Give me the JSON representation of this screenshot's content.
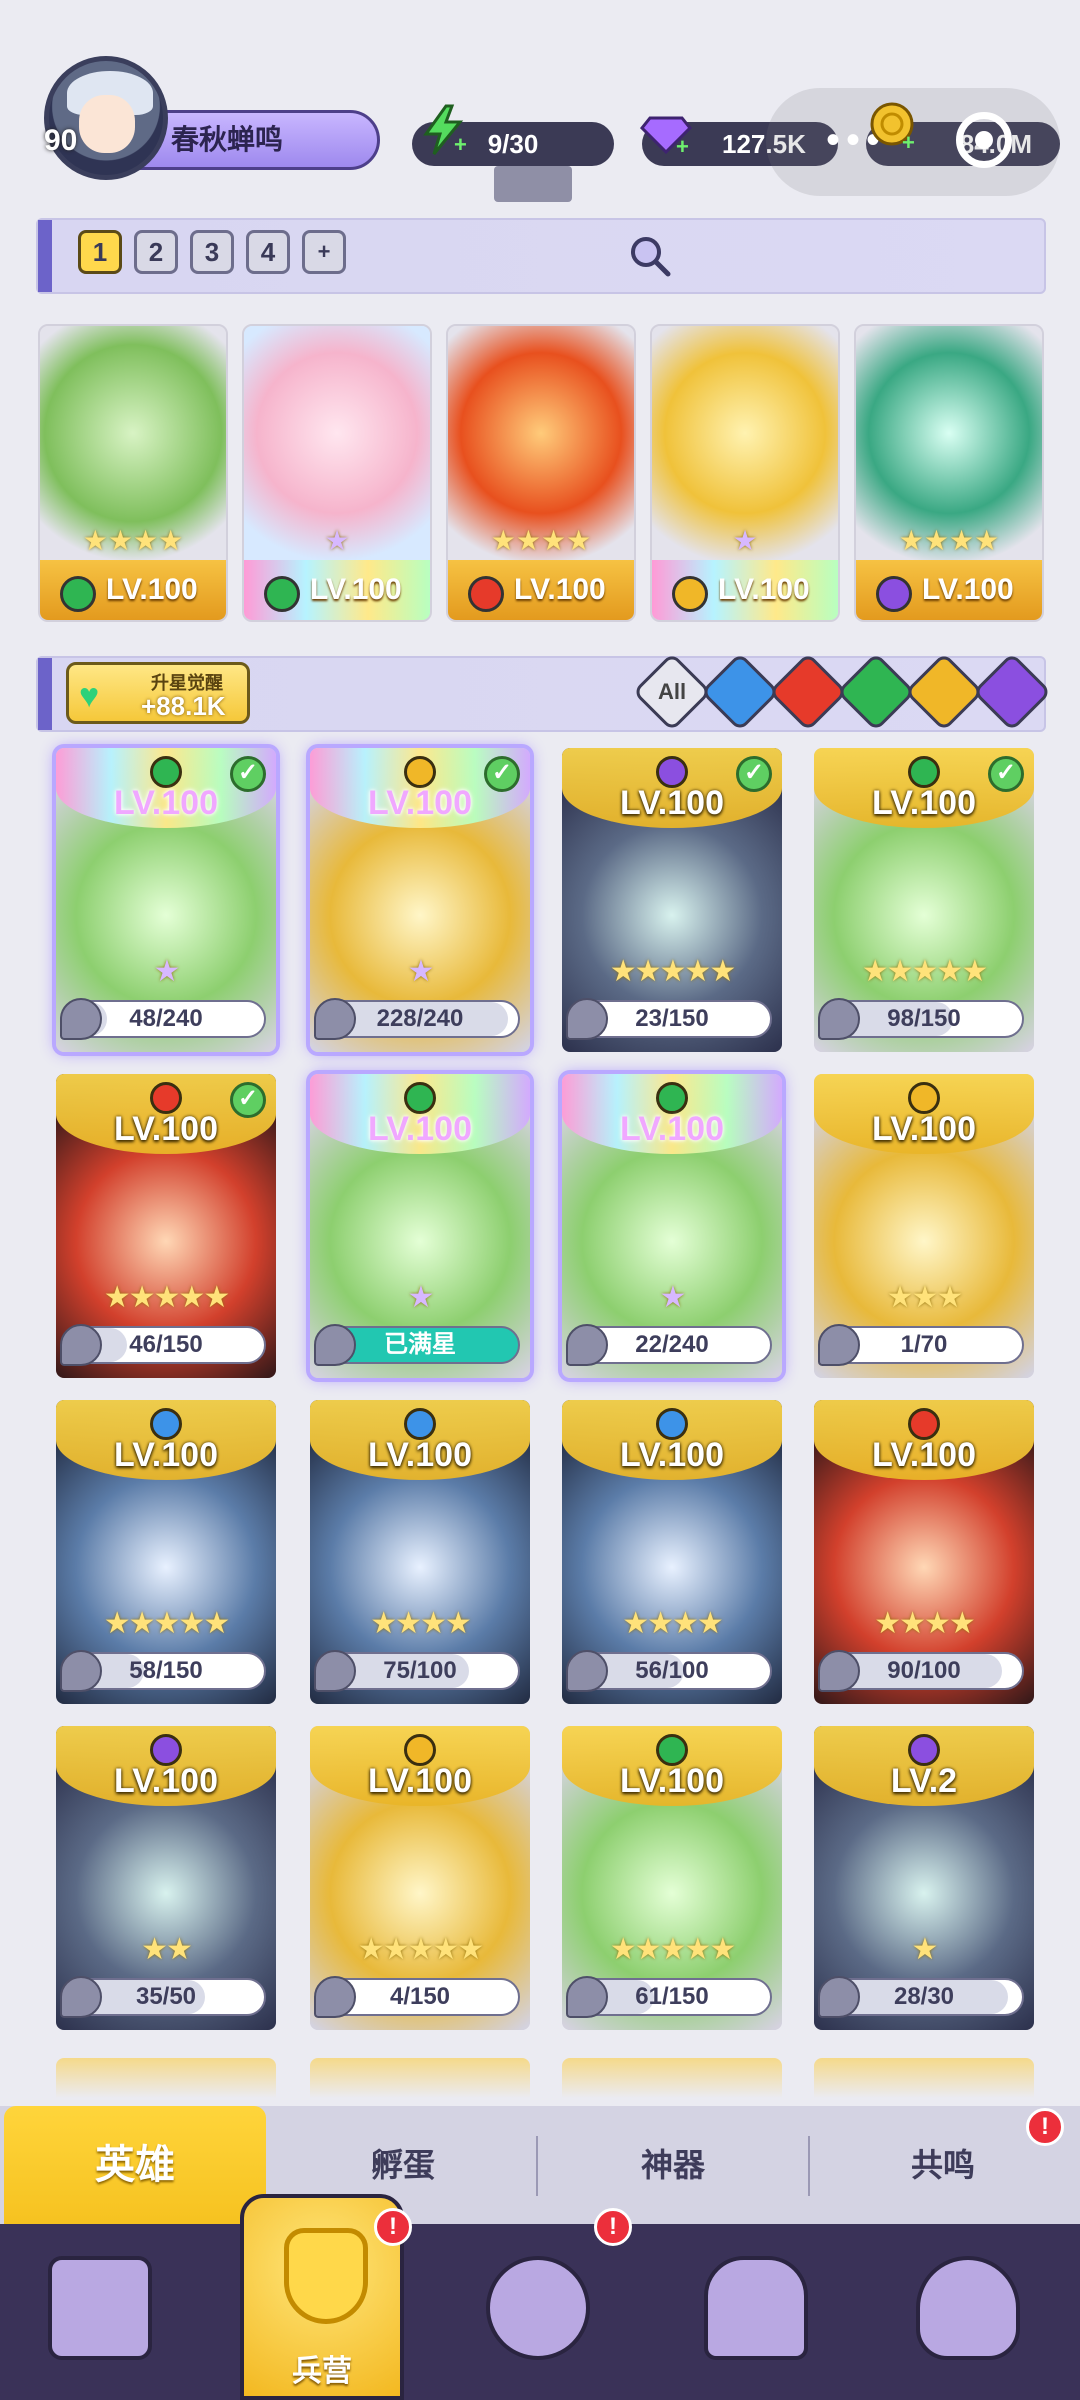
{
  "player": {
    "level": "90",
    "name": "春秋蝉鸣"
  },
  "resources": {
    "energy": "9/30",
    "gems": "127.5K",
    "coins": "84.0M"
  },
  "teams": {
    "tabs": [
      "1",
      "2",
      "3",
      "4",
      "+"
    ],
    "active": "1"
  },
  "featured": [
    {
      "level": "LV.100",
      "element": "green",
      "stars": "★★★★"
    },
    {
      "level": "LV.100",
      "element": "green",
      "stars": "★"
    },
    {
      "level": "LV.100",
      "element": "red",
      "stars": "★★★★"
    },
    {
      "level": "LV.100",
      "element": "gold",
      "stars": "★"
    },
    {
      "level": "LV.100",
      "element": "purple",
      "stars": "★★★★"
    }
  ],
  "awaken": {
    "label": "升星觉醒",
    "value": "+88.1K"
  },
  "filters": {
    "all": "All",
    "elements": [
      "blue",
      "red",
      "green",
      "gold",
      "purple"
    ]
  },
  "heroes": [
    {
      "level": "LV.100",
      "element": "green",
      "rainbow": true,
      "checked": true,
      "stars": "★",
      "progress": "48/240",
      "fill": 0.2,
      "selected": true
    },
    {
      "level": "LV.100",
      "element": "gold",
      "rainbow": true,
      "checked": true,
      "stars": "★",
      "progress": "228/240",
      "fill": 0.95,
      "selected": true
    },
    {
      "level": "LV.100",
      "element": "purple",
      "rainbow": false,
      "checked": true,
      "stars": "★★★★★",
      "progress": "23/150",
      "fill": 0.15
    },
    {
      "level": "LV.100",
      "element": "green",
      "rainbow": false,
      "checked": true,
      "stars": "★★★★★",
      "progress": "98/150",
      "fill": 0.65
    },
    {
      "level": "LV.100",
      "element": "red",
      "rainbow": false,
      "checked": true,
      "stars": "★★★★★",
      "progress": "46/150",
      "fill": 0.3
    },
    {
      "level": "LV.100",
      "element": "green",
      "rainbow": true,
      "checked": false,
      "stars": "★",
      "progress": "已满星",
      "fill": 1,
      "full": true,
      "selected": true
    },
    {
      "level": "LV.100",
      "element": "green",
      "rainbow": true,
      "checked": false,
      "stars": "★",
      "progress": "22/240",
      "fill": 0.09,
      "selected": true
    },
    {
      "level": "LV.100",
      "element": "gold",
      "rainbow": false,
      "checked": false,
      "stars": "★★★",
      "progress": "1/70",
      "fill": 0.02
    },
    {
      "level": "LV.100",
      "element": "blue",
      "rainbow": false,
      "checked": false,
      "stars": "★★★★★",
      "progress": "58/150",
      "fill": 0.39
    },
    {
      "level": "LV.100",
      "element": "blue",
      "rainbow": false,
      "checked": false,
      "stars": "★★★★",
      "progress": "75/100",
      "fill": 0.75
    },
    {
      "level": "LV.100",
      "element": "blue",
      "rainbow": false,
      "checked": false,
      "stars": "★★★★",
      "progress": "56/100",
      "fill": 0.56
    },
    {
      "level": "LV.100",
      "element": "red",
      "rainbow": false,
      "checked": false,
      "stars": "★★★★",
      "progress": "90/100",
      "fill": 0.9
    },
    {
      "level": "LV.100",
      "element": "purple",
      "rainbow": false,
      "checked": false,
      "stars": "★★",
      "progress": "35/50",
      "fill": 0.7
    },
    {
      "level": "LV.100",
      "element": "gold",
      "rainbow": false,
      "checked": false,
      "stars": "★★★★★",
      "progress": "4/150",
      "fill": 0.03
    },
    {
      "level": "LV.100",
      "element": "green",
      "rainbow": false,
      "checked": false,
      "stars": "★★★★★",
      "progress": "61/150",
      "fill": 0.41
    },
    {
      "level": "LV.2",
      "element": "purple",
      "rainbow": false,
      "checked": false,
      "stars": "★",
      "progress": "28/30",
      "fill": 0.93
    }
  ],
  "tabs": [
    "英雄",
    "孵蛋",
    "神器",
    "共鸣"
  ],
  "active_tab": "英雄",
  "nav": {
    "barracks_label": "兵营",
    "badge": "!"
  },
  "colors": {
    "green": "#2fb552",
    "red": "#e63a2a",
    "gold": "#f0b728",
    "purple": "#8b4fe0",
    "blue": "#3d93e8",
    "yellow_card": "#f5c93a",
    "nav_bg": "#3a3258"
  }
}
